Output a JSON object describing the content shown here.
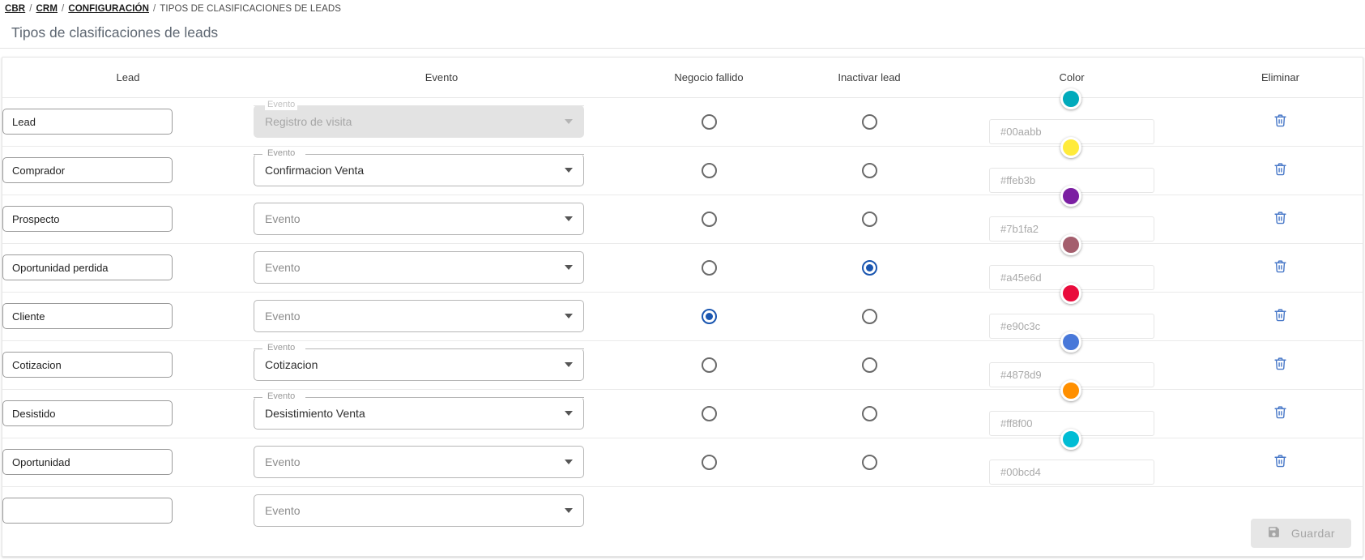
{
  "breadcrumb": {
    "items": [
      {
        "label": "CBR",
        "link": true
      },
      {
        "label": "CRM",
        "link": true
      },
      {
        "label": "CONFIGURACIÓN",
        "link": true
      },
      {
        "label": "TIPOS DE CLASIFICACIONES DE LEADS",
        "link": false
      }
    ],
    "separator": "/"
  },
  "page": {
    "title": "Tipos de clasificaciones de leads"
  },
  "table": {
    "headers": [
      "Lead",
      "Evento",
      "Negocio fallido",
      "Inactivar lead",
      "Color",
      "Eliminar"
    ],
    "evento_label": "Evento",
    "evento_placeholder": "Evento",
    "lead_placeholder": "",
    "rows": [
      {
        "lead": "Lead",
        "evento": "Registro de visita",
        "evento_disabled": true,
        "negocio_fallido": false,
        "inactivar_lead": false,
        "color": "#00aabb",
        "color_hex_text": "#00aabb",
        "delete_icon": "trash-icon"
      },
      {
        "lead": "Comprador",
        "evento": "Confirmacion Venta",
        "evento_disabled": false,
        "negocio_fallido": false,
        "inactivar_lead": false,
        "color": "#ffeb3b",
        "color_hex_text": "#ffeb3b",
        "delete_icon": "trash-icon"
      },
      {
        "lead": "Prospecto",
        "evento": "",
        "evento_disabled": false,
        "negocio_fallido": false,
        "inactivar_lead": false,
        "color": "#7b1fa2",
        "color_hex_text": "#7b1fa2",
        "delete_icon": "trash-icon"
      },
      {
        "lead": "Oportunidad perdida",
        "evento": "",
        "evento_disabled": false,
        "negocio_fallido": false,
        "inactivar_lead": true,
        "color": "#a45e6d",
        "color_hex_text": "#a45e6d",
        "delete_icon": "trash-icon"
      },
      {
        "lead": "Cliente",
        "evento": "",
        "evento_disabled": false,
        "negocio_fallido": true,
        "inactivar_lead": false,
        "color": "#e90c3c",
        "color_hex_text": "#e90c3c",
        "delete_icon": "trash-icon"
      },
      {
        "lead": "Cotizacion",
        "evento": "Cotizacion",
        "evento_disabled": false,
        "negocio_fallido": false,
        "inactivar_lead": false,
        "color": "#4878d9",
        "color_hex_text": "#4878d9",
        "delete_icon": "trash-icon"
      },
      {
        "lead": "Desistido",
        "evento": "Desistimiento Venta",
        "evento_disabled": false,
        "negocio_fallido": false,
        "inactivar_lead": false,
        "color": "#ff8f00",
        "color_hex_text": "#ff8f00",
        "delete_icon": "trash-icon"
      },
      {
        "lead": "Oportunidad",
        "evento": "",
        "evento_disabled": false,
        "negocio_fallido": false,
        "inactivar_lead": false,
        "color": "#00bcd4",
        "color_hex_text": "#00bcd4",
        "delete_icon": "trash-icon"
      },
      {
        "lead": "",
        "evento": "",
        "evento_disabled": false,
        "negocio_fallido": null,
        "inactivar_lead": null,
        "color": null,
        "color_hex_text": null,
        "delete_icon": null
      }
    ]
  },
  "footer": {
    "save_label": "Guardar",
    "save_icon": "save-floppy-icon",
    "save_disabled": true
  },
  "colors": {
    "radio_selected": "#1a56b0",
    "radio_unselected": "#6a6a6a",
    "trash_icon": "#4878c8",
    "title_text": "#5d6671",
    "save_button_bg": "#e6e6e6",
    "save_button_text": "#a5a5a5"
  }
}
